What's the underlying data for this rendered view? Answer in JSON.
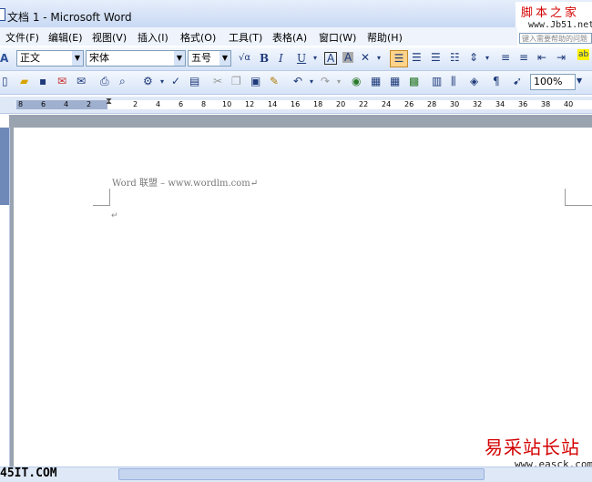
{
  "window": {
    "title": "文档 1 - Microsoft Word"
  },
  "watermark_top": {
    "cn": "脚本之家",
    "url": "www.Jb51.net"
  },
  "help_box": {
    "placeholder": "键入需要帮助的问题"
  },
  "menu": [
    {
      "label": "文件(F)"
    },
    {
      "label": "编辑(E)"
    },
    {
      "label": "视图(V)"
    },
    {
      "label": "插入(I)"
    },
    {
      "label": "格式(O)"
    },
    {
      "label": "工具(T)"
    },
    {
      "label": "表格(A)"
    },
    {
      "label": "窗口(W)"
    },
    {
      "label": "帮助(H)"
    }
  ],
  "formatting": {
    "style": "正文",
    "font": "宋体",
    "size": "五号"
  },
  "standard": {
    "zoom": "100%"
  },
  "ruler_numbers": [
    "8",
    "6",
    "4",
    "2",
    "2",
    "4",
    "6",
    "8",
    "10",
    "12",
    "14",
    "16",
    "18",
    "20",
    "22",
    "24",
    "26",
    "28",
    "30",
    "32",
    "34",
    "36",
    "38",
    "40"
  ],
  "document": {
    "line1": "Word 联盟 – www.wordlm.com↵",
    "para_mark": "↵"
  },
  "watermark_bottom": {
    "cn": "易采站长站",
    "url": "www.easck.com"
  },
  "watermark_left": {
    "text": "45IT.COM"
  },
  "colors": {
    "titlebar": "#c9d9f4",
    "toolbar": "#d6e3f7",
    "watermark_red": "#d40000",
    "selected_button": "#ffd48a"
  }
}
